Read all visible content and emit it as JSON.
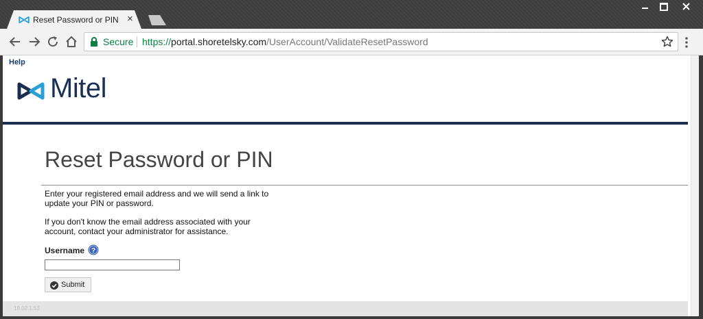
{
  "browser": {
    "tab_title": "Reset Password or PIN",
    "tab_close": "×",
    "secure_label": "Secure",
    "url_scheme": "https://",
    "url_host": "portal.shoretelsky.com",
    "url_path": "/UserAccount/ValidateResetPassword",
    "icons": [
      "back-arrow-icon",
      "forward-arrow-icon",
      "reload-icon",
      "home-icon",
      "lock-icon",
      "star-icon",
      "kebab-menu-icon"
    ]
  },
  "page": {
    "help_link": "Help",
    "logo_text": "Mitel",
    "title": "Reset Password or PIN",
    "intro_line1": "Enter your registered email address and we will send a link to",
    "intro_line2": "update your PIN or password.",
    "info_line1": "If you don't know the email address associated with your",
    "info_line2": "account, contact your administrator for assistance.",
    "username_label": "Username",
    "username_value": "",
    "submit_label": "Submit",
    "footer_text": "18.02.1.53"
  },
  "colors": {
    "brand_navy": "#1c2d52",
    "brand_blue": "#2a9fd8",
    "secure_green": "#0b8043"
  }
}
